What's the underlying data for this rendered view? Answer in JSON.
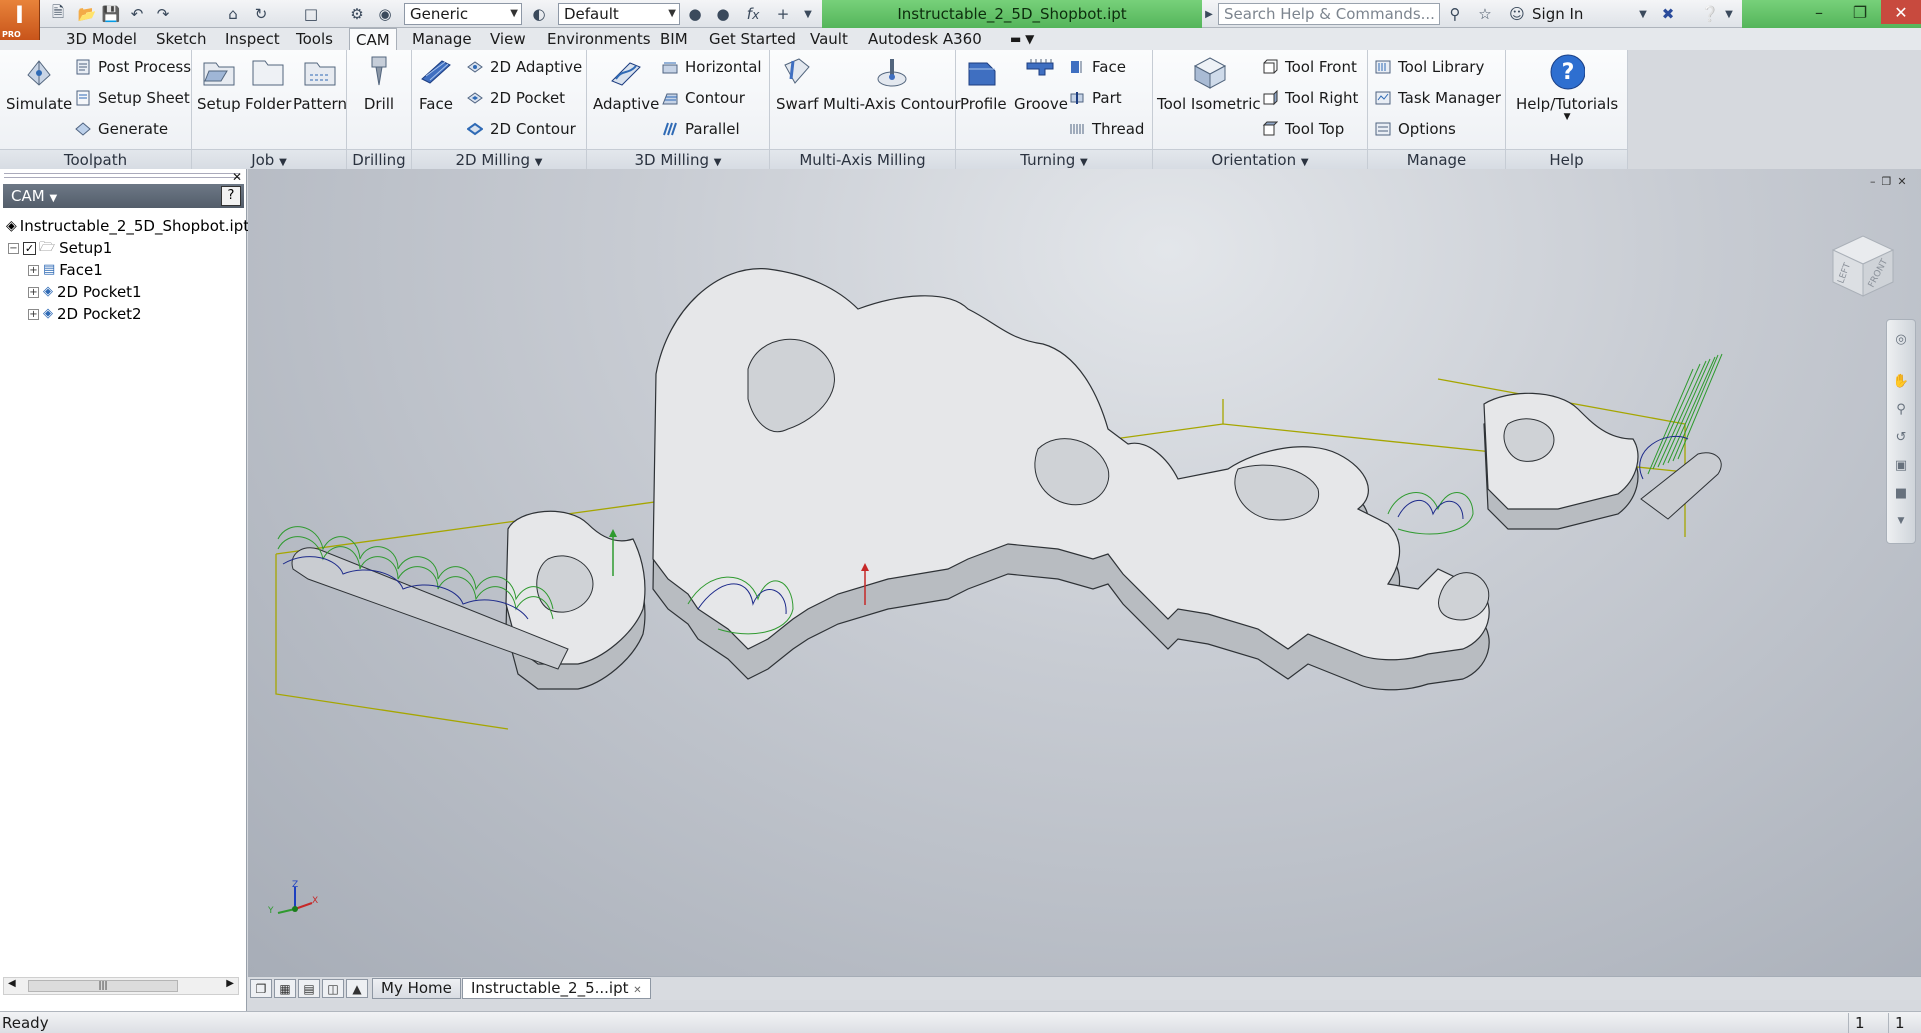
{
  "app": {
    "logo_letter": "I",
    "logo_edition": "PRO",
    "document_title": "Instructable_2_5D_Shopbot.ipt",
    "search_placeholder": "Search Help & Commands...",
    "sign_in": "Sign In",
    "material_combo": "Generic",
    "appearance_combo": "Default"
  },
  "menu_tabs": [
    "3D Model",
    "Sketch",
    "Inspect",
    "Tools",
    "CAM",
    "Manage",
    "View",
    "Environments",
    "BIM",
    "Get Started",
    "Vault",
    "Autodesk A360"
  ],
  "active_tab": "CAM",
  "ribbon": {
    "toolpath": {
      "title": "Toolpath",
      "simulate": "Simulate",
      "post_process": "Post Process",
      "setup_sheet": "Setup Sheet",
      "generate": "Generate"
    },
    "job": {
      "title": "Job",
      "setup": "Setup",
      "folder": "Folder",
      "pattern": "Pattern"
    },
    "drilling": {
      "title": "Drilling",
      "drill": "Drill"
    },
    "milling2d": {
      "title": "2D Milling",
      "face": "Face",
      "adaptive": "2D Adaptive",
      "pocket": "2D Pocket",
      "contour": "2D Contour"
    },
    "milling3d": {
      "title": "3D Milling",
      "adaptive": "Adaptive",
      "horizontal": "Horizontal",
      "contour": "Contour",
      "parallel": "Parallel"
    },
    "multiaxis": {
      "title": "Multi-Axis Milling",
      "swarf": "Swarf",
      "contour": "Multi-Axis Contour"
    },
    "turning": {
      "title": "Turning",
      "profile": "Profile",
      "groove": "Groove",
      "face": "Face",
      "part": "Part",
      "thread": "Thread"
    },
    "orientation": {
      "title": "Orientation",
      "tool_isometric": "Tool Isometric",
      "tool_front": "Tool Front",
      "tool_right": "Tool Right",
      "tool_top": "Tool Top"
    },
    "manage": {
      "title": "Manage",
      "tool_library": "Tool Library",
      "task_manager": "Task Manager",
      "options": "Options"
    },
    "help": {
      "title": "Help",
      "tutorials": "Help/Tutorials"
    }
  },
  "browser": {
    "title": "CAM",
    "root": "Instructable_2_5D_Shopbot.ipt O",
    "setup": "Setup1",
    "operations": [
      "Face1",
      "2D Pocket1",
      "2D Pocket2"
    ]
  },
  "viewcube": {
    "face_left": "LEFT",
    "face_front": "FRONT"
  },
  "doc_tabs": {
    "home": "My Home",
    "document": "Instructable_2_5...ipt"
  },
  "status": {
    "text": "Ready",
    "count1": "1",
    "count2": "1"
  },
  "colors": {
    "title_green": "#5fbf63",
    "ribbon_bg": "#f4f6f8",
    "toolpath_green": "#2f9a2f",
    "toolpath_blue": "#1d2a8a",
    "stock_yellow": "#b8b800"
  }
}
